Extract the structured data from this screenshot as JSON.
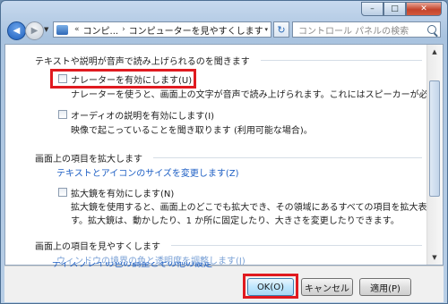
{
  "window": {
    "caption_buttons": {
      "minimize": "–",
      "maximize": "□",
      "close": "✕"
    }
  },
  "navbar": {
    "address": {
      "prefix": "«",
      "part1": "コンピ...",
      "separator": "›",
      "part2": "コンピューターを見やすくします",
      "dropdown": "▾"
    },
    "refresh_icon": "refresh-icon",
    "search_placeholder": "コントロール パネルの検索"
  },
  "sections": {
    "text_audio": {
      "title": "テキストや説明が音声で読み上げられるのを聞きます",
      "narrator": {
        "label": "ナレーターを有効にします(U)",
        "description": "ナレーターを使うと、画面上の文字が音声で読み上げられます。これにはスピーカーが必要です。"
      },
      "audio_desc": {
        "label": "オーディオの説明を有効にします(I)",
        "description": "映像で起こっていることを聞き取ります (利用可能な場合)。"
      }
    },
    "enlarge": {
      "title": "画面上の項目を拡大します",
      "link": "テキストとアイコンのサイズを変更します(Z)",
      "magnifier": {
        "label": "拡大鏡を有効にします(N)",
        "description_line1": "拡大鏡を使用すると、画面上のどこでも拡大でき、その領域にあるすべての項目を拡大表示できま",
        "description_line2": "す。拡大鏡は、動かしたり、1 か所に固定したり、大きさを変更したりできます。"
      }
    },
    "easier": {
      "title": "画面上の項目を見やすくします",
      "link": "ウィンドウの境界の色と透明度を調整します(J)",
      "link_partial": "ディスプレイの色の調整とその他の設定"
    }
  },
  "footer": {
    "ok": "OK(O)",
    "cancel": "キャンセル",
    "apply": "適用(P)"
  },
  "colors": {
    "highlight": "#e01a20",
    "link": "#1e5fc4"
  }
}
